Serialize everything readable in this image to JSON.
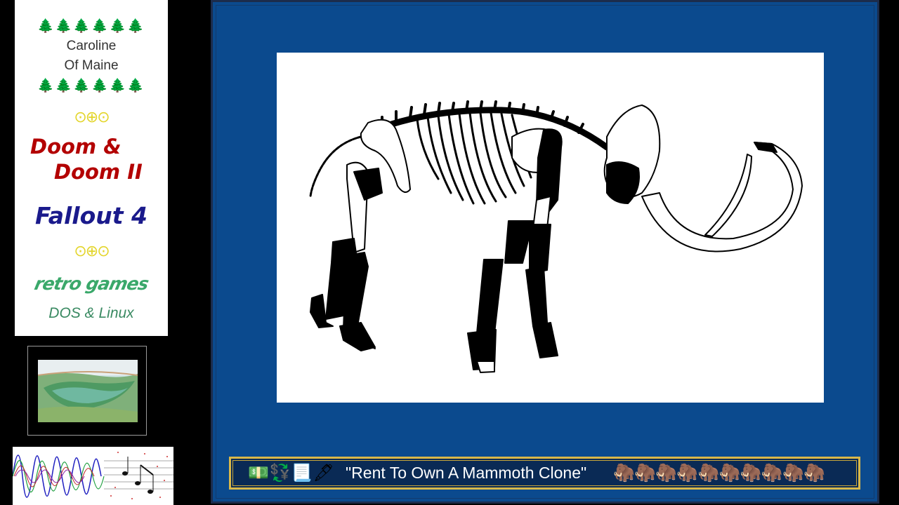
{
  "channel_card": {
    "trees": "🌲🌲🌲🌲🌲🌲",
    "name_line1": "Caroline",
    "name_line2": "Of Maine",
    "dots": "⊙⊕⊙",
    "game1_line1": "Doom &",
    "game1_line2": "Doom II",
    "game2": "Fallout 4",
    "retro": "retro games",
    "platforms": "DOS & Linux"
  },
  "caption": {
    "icons": "💵💱📃🖋",
    "title": "\"Rent To Own A Mammoth Clone\"",
    "mammoths": "🦣🦣🦣🦣🦣🦣🦣🦣🦣🦣"
  },
  "colors": {
    "stage_blue": "#0b4a8e",
    "caption_bg": "#0a2a55",
    "caption_border": "#d9b84a",
    "doom_red": "#b30000",
    "fallout_blue": "#1a1a8c",
    "retro_green": "#3aa86a"
  }
}
